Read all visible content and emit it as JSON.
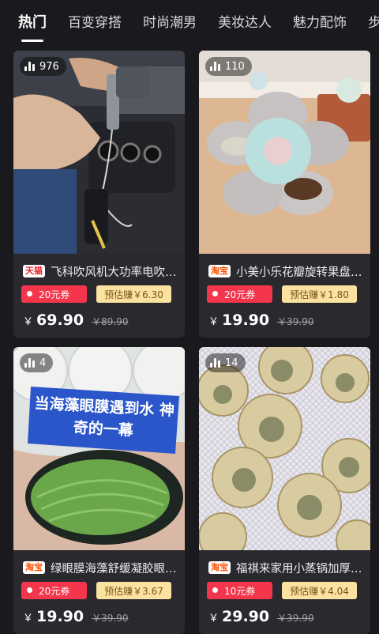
{
  "tabs": [
    "热门",
    "百变穿搭",
    "时尚潮男",
    "美妆达人",
    "魅力配饰",
    "步履不停"
  ],
  "active_tab": 0,
  "products": [
    {
      "views": "976",
      "shop": "天猫",
      "title": "飞科吹风机大功率电吹风机家用",
      "coupon": "20元券",
      "earn": "预估赚￥6.30",
      "price": "69.90",
      "original": "89.90"
    },
    {
      "views": "110",
      "shop": "淘宝",
      "title": "小美小乐花瓣旋转果盘干果盒",
      "coupon": "20元券",
      "earn": "预估赚￥1.80",
      "price": "19.90",
      "original": "39.90"
    },
    {
      "views": "4",
      "shop": "淘宝",
      "title": "绿眼膜海藻舒缓凝胶眼贴膜",
      "coupon": "20元券",
      "earn": "预估赚￥3.67",
      "price": "19.90",
      "original": "39.90",
      "image_caption": "当海藻眼膜遇到水 神奇的一幕"
    },
    {
      "views": "14",
      "shop": "淘宝",
      "title": "福祺来家用小蒸锅加厚不锈钢",
      "coupon": "10元券",
      "earn": "预估赚￥4.04",
      "price": "29.90",
      "original": "39.90"
    }
  ],
  "currency": "￥",
  "colors": {
    "background": "#1a1a1e",
    "card": "#29292e",
    "coupon": "#f4364c",
    "earn_bg": "#fbe2a0",
    "tmall": "#e0262e",
    "taobao": "#ff5000"
  }
}
